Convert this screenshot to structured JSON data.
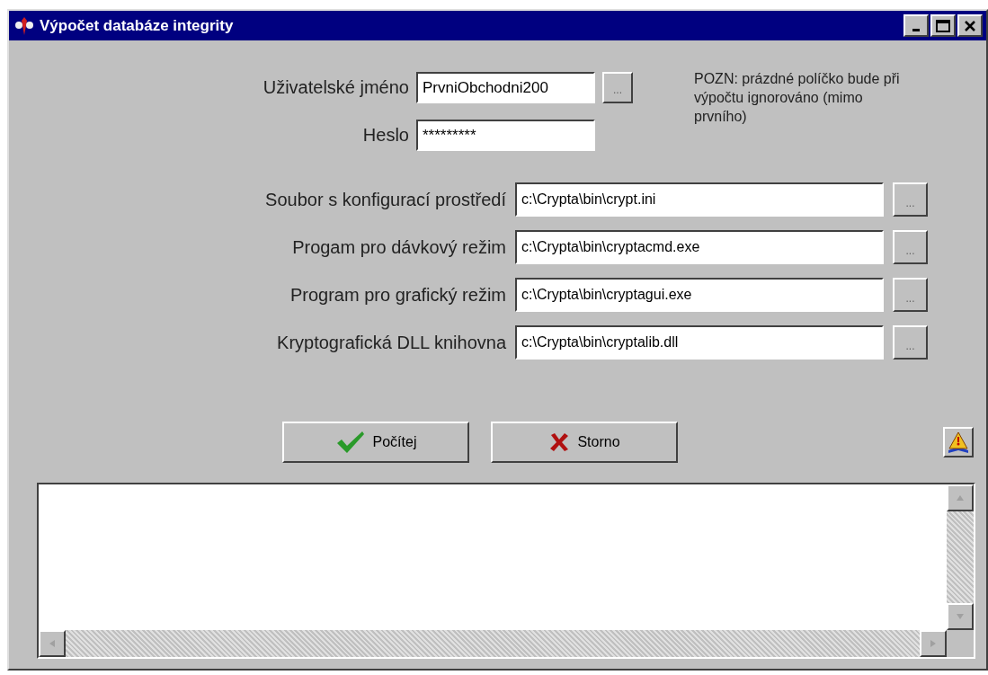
{
  "window": {
    "title": "Výpočet databáze integrity"
  },
  "login": [
    {
      "label": "Uživatelské jméno",
      "value": "PrvniObchodni200",
      "browse": "..."
    },
    {
      "label": "Heslo",
      "value": "*********"
    }
  ],
  "note": "POZN: prázdné políčko bude při výpočtu ignorováno (mimo prvního)",
  "paths": [
    {
      "label": "Soubor s konfigurací prostředí",
      "value": "c:\\Crypta\\bin\\crypt.ini",
      "browse": "..."
    },
    {
      "label": "Progam pro dávkový režim",
      "value": "c:\\Crypta\\bin\\cryptacmd.exe",
      "browse": "..."
    },
    {
      "label": "Program pro grafický režim",
      "value": "c:\\Crypta\\bin\\cryptagui.exe",
      "browse": "..."
    },
    {
      "label": "Kryptografická DLL knihovna",
      "value": "c:\\Crypta\\bin\\cryptalib.dll",
      "browse": "..."
    }
  ],
  "actions": [
    {
      "kind": "ok",
      "label": "Počítej"
    },
    {
      "kind": "cancel",
      "label": "Storno"
    }
  ]
}
